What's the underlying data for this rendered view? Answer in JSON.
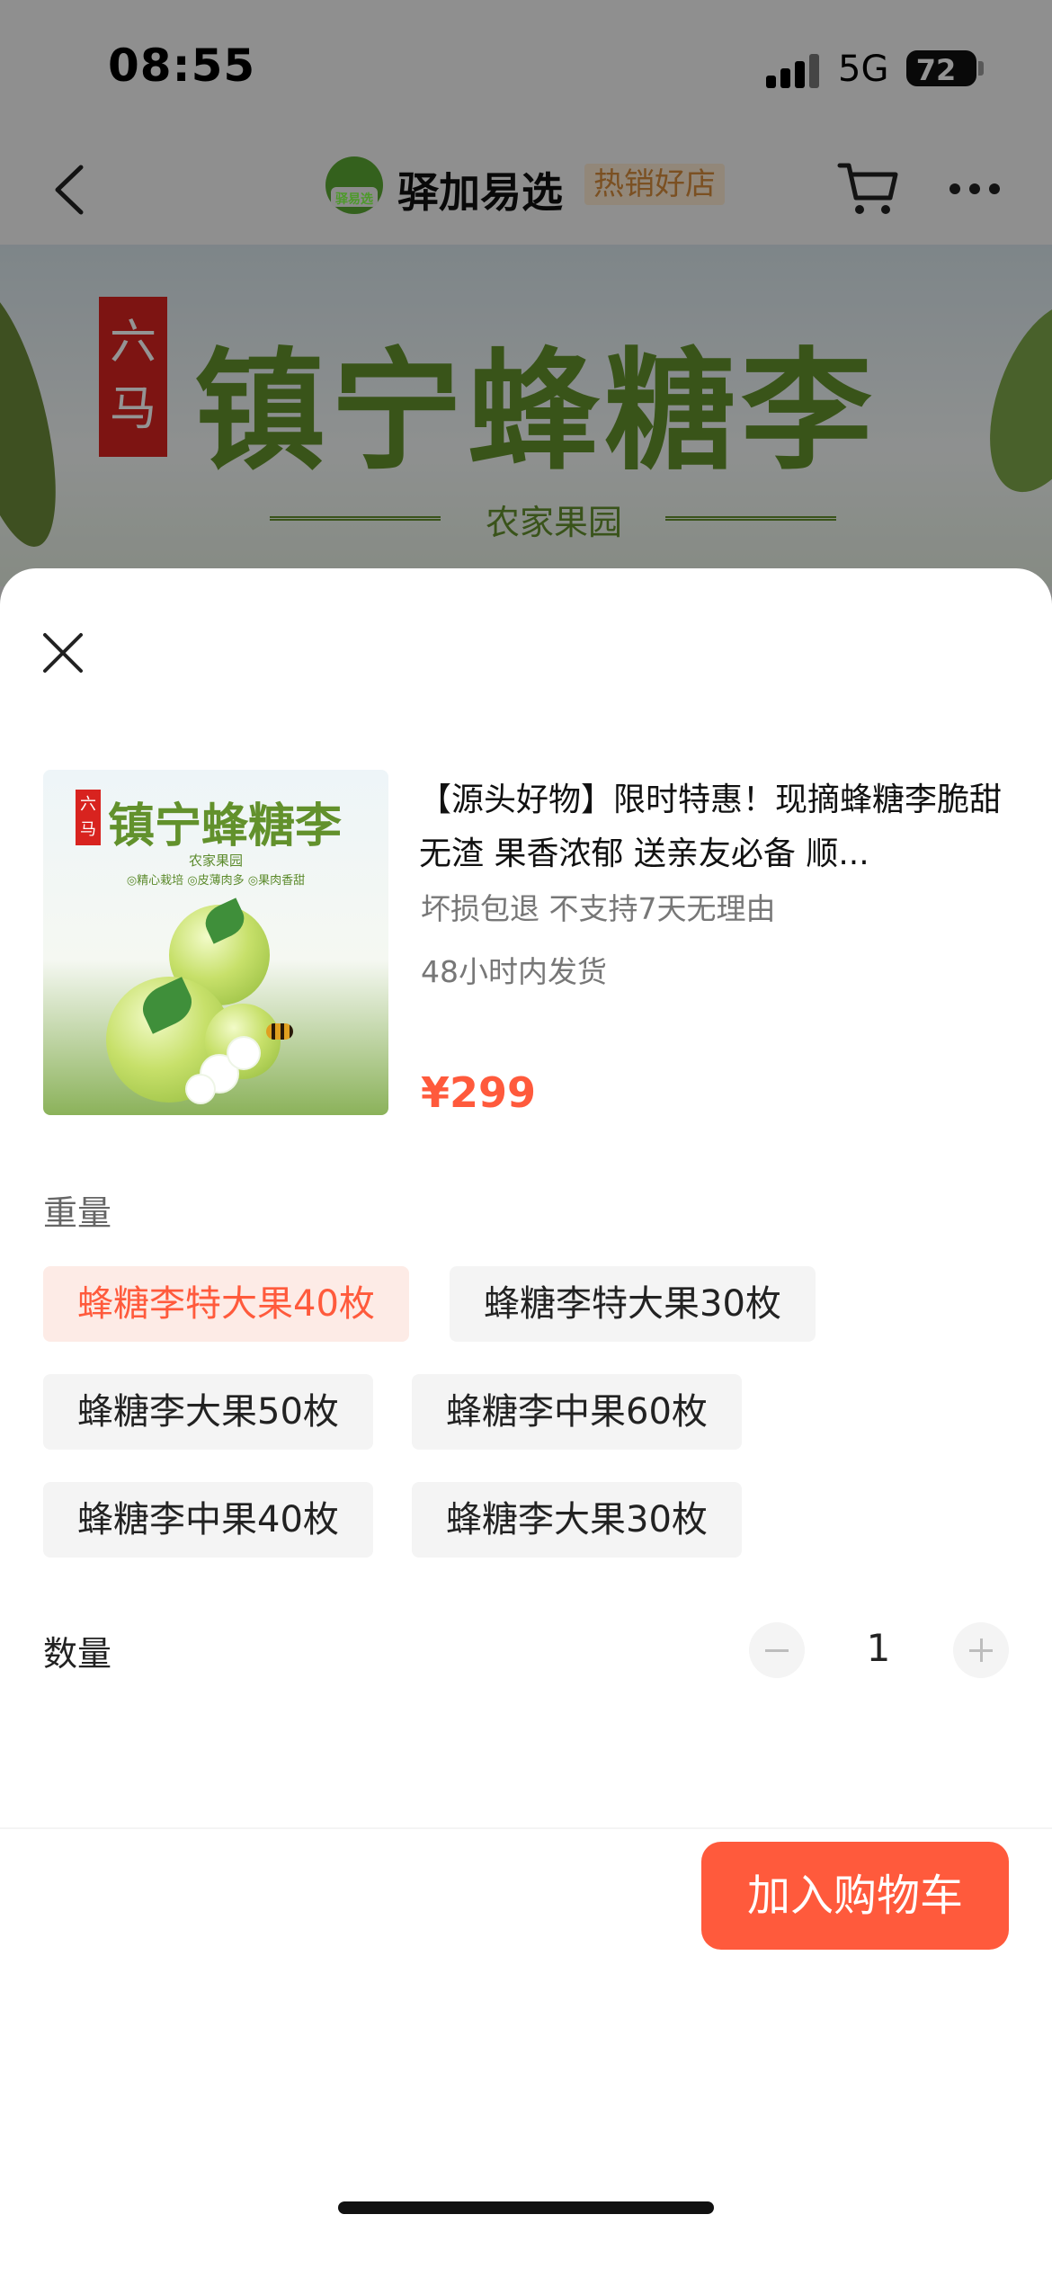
{
  "status_bar": {
    "time": "08:55",
    "network": "5G",
    "battery": "72"
  },
  "nav": {
    "shop_name": "驿加易选",
    "shop_badge": "热销好店",
    "logo_text": "驿易选"
  },
  "banner": {
    "tag": "六马",
    "title": "镇宁蜂糖李",
    "subtitle": "农家果园"
  },
  "thumbnail": {
    "tag": "六马",
    "title": "镇宁蜂糖李",
    "subtitle": "农家果园",
    "points": "◎精心栽培 ◎皮薄肉多 ◎果肉香甜"
  },
  "product": {
    "title": "【源头好物】限时特惠！现摘蜂糖李脆甜无渣 果香浓郁 送亲友必备 顺...",
    "service": "坏损包退 不支持7天无理由",
    "shipping": "48小时内发货",
    "price": "¥299"
  },
  "weight": {
    "label": "重量",
    "options": [
      {
        "label": "蜂糖李特大果40枚",
        "selected": true
      },
      {
        "label": "蜂糖李特大果30枚",
        "selected": false
      },
      {
        "label": "蜂糖李大果50枚",
        "selected": false
      },
      {
        "label": "蜂糖李中果60枚",
        "selected": false
      },
      {
        "label": "蜂糖李中果40枚",
        "selected": false
      },
      {
        "label": "蜂糖李大果30枚",
        "selected": false
      }
    ]
  },
  "quantity": {
    "label": "数量",
    "value": "1"
  },
  "actions": {
    "add_to_cart": "加入购物车"
  },
  "icons": [
    "back-icon",
    "cart-icon",
    "more-icon",
    "close-icon",
    "minus-icon",
    "plus-icon"
  ],
  "colors": {
    "accent": "#ff5a3c",
    "selected_bg": "#fdebe6",
    "chip_bg": "#f4f4f4",
    "brand_green": "#5aa832"
  }
}
